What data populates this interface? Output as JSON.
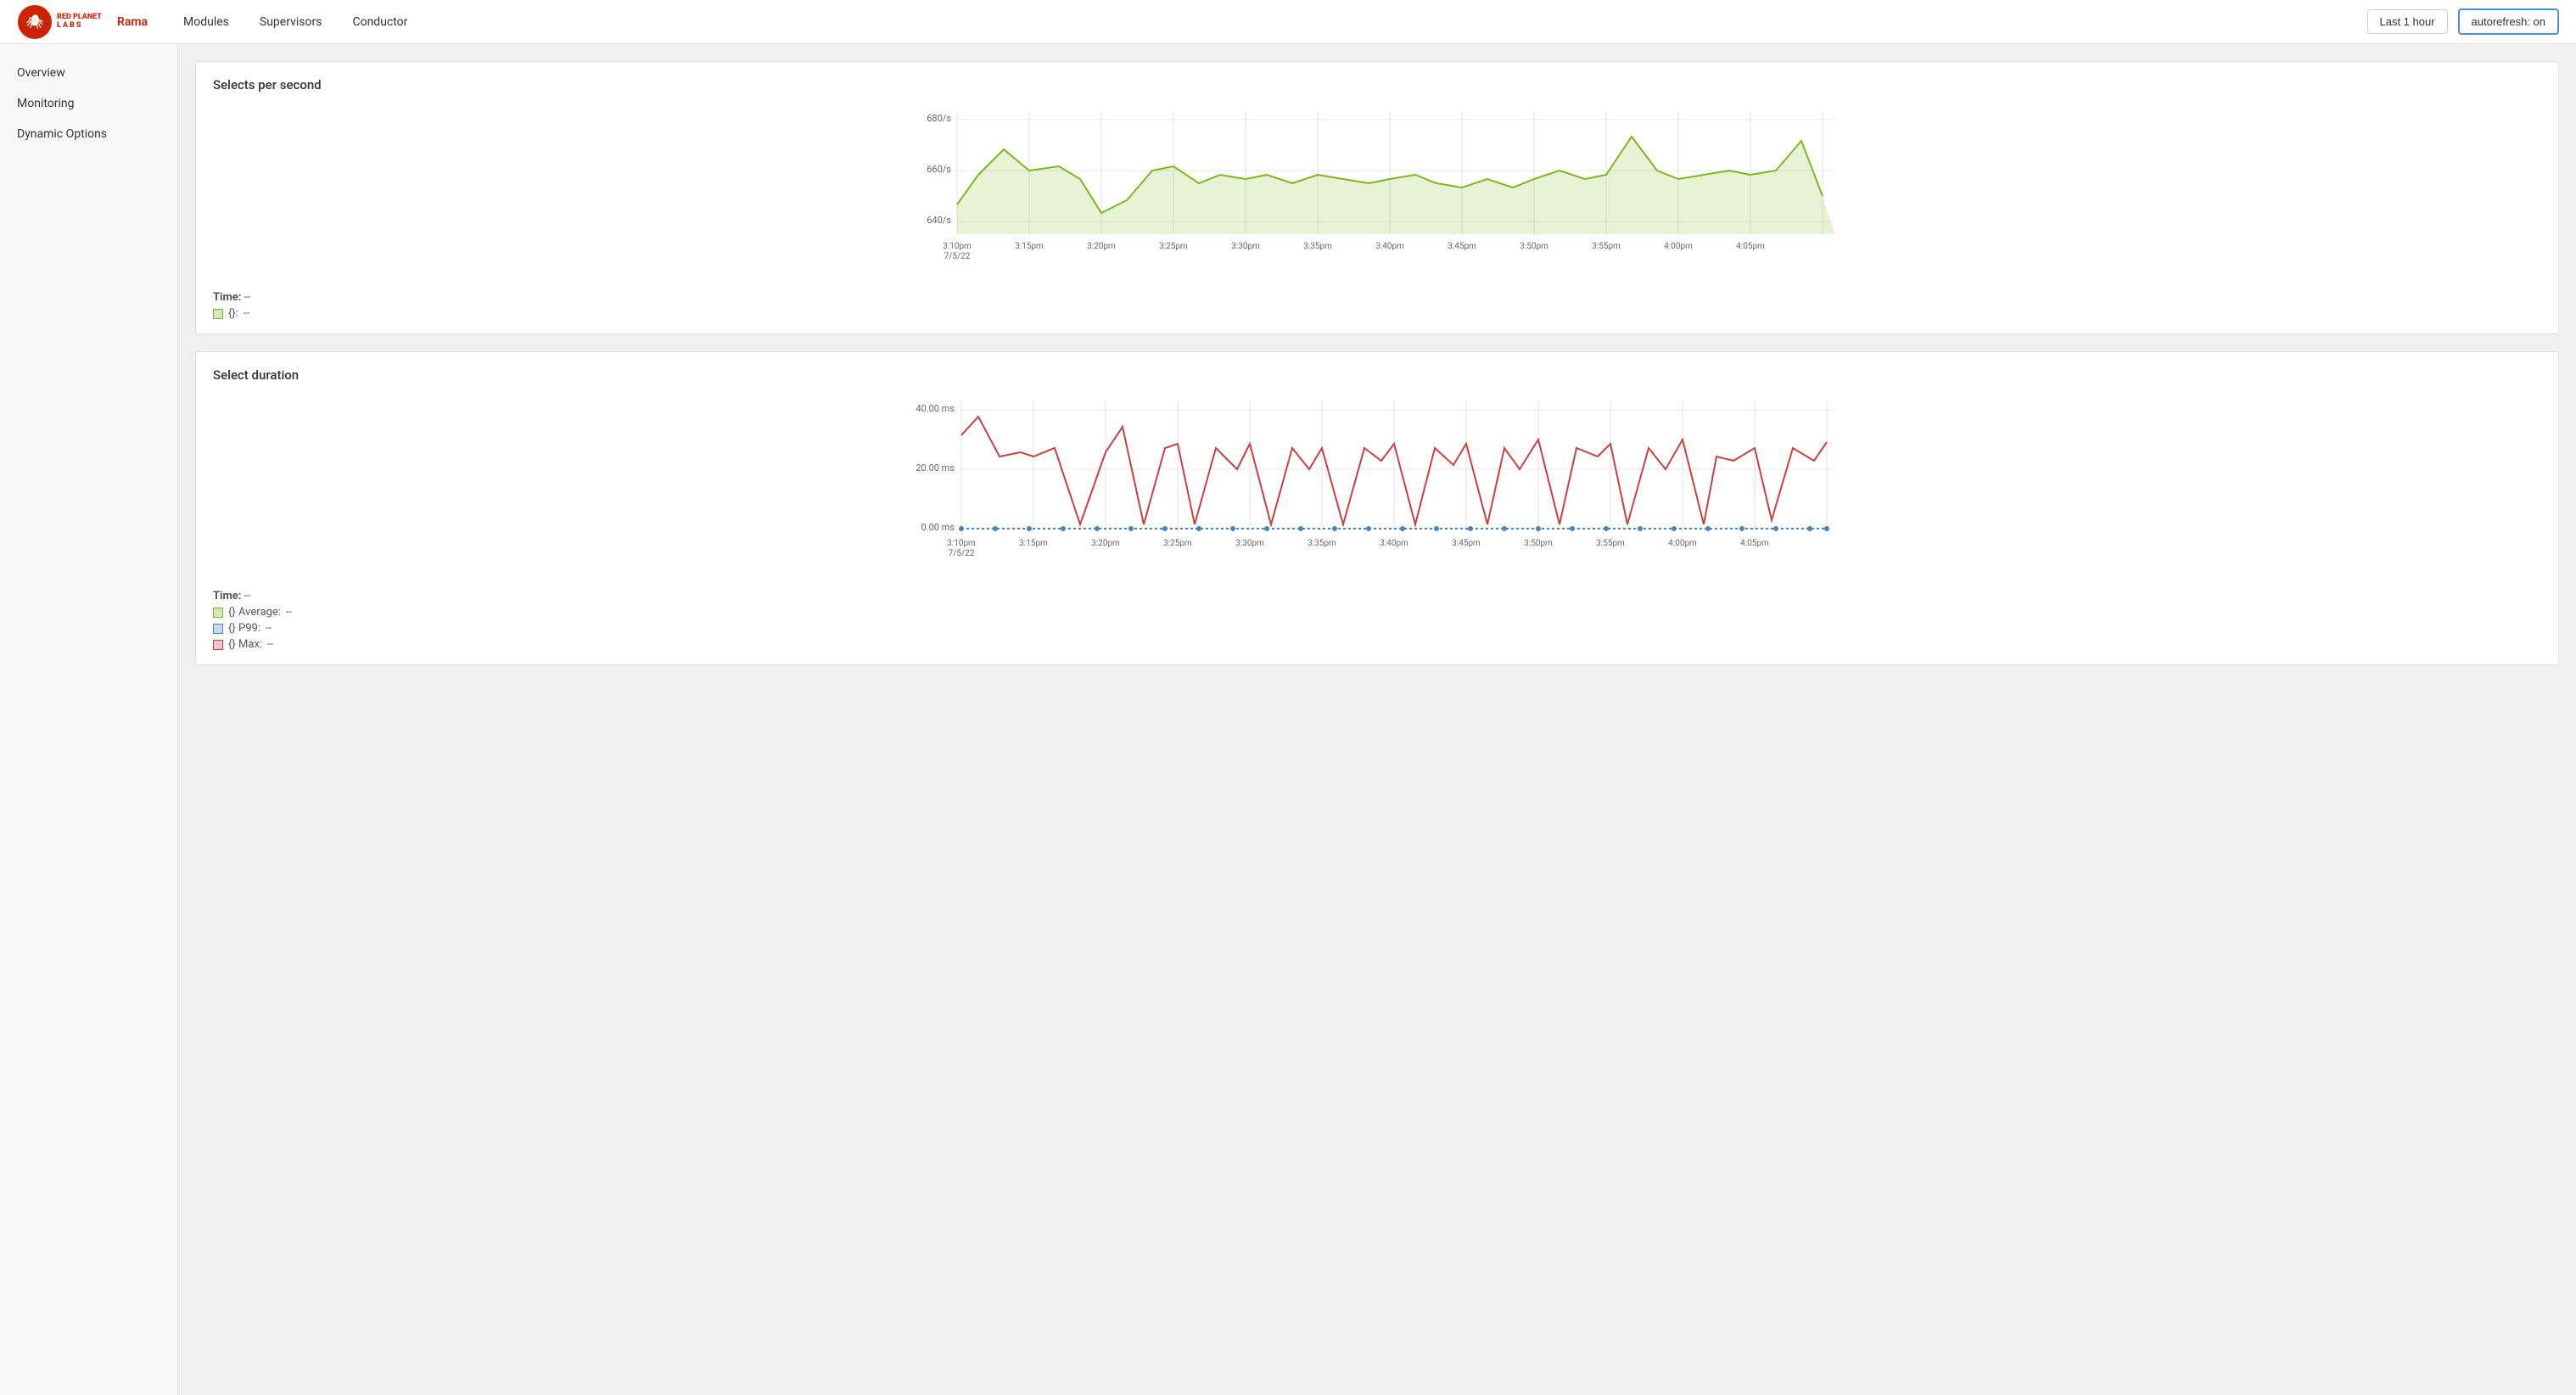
{
  "header": {
    "brand_line1": "RED PLANET",
    "brand_line2": "LABS",
    "app_name": "Rama",
    "nav_items": [
      "Modules",
      "Supervisors",
      "Conductor"
    ],
    "time_range_label": "Last 1 hour",
    "autorefresh_label": "autorefresh: on"
  },
  "sidebar": {
    "items": [
      {
        "label": "Overview"
      },
      {
        "label": "Monitoring"
      },
      {
        "label": "Dynamic Options"
      }
    ]
  },
  "chart1": {
    "title": "Selects per second",
    "y_labels": [
      "680/s",
      "660/s",
      "640/s"
    ],
    "x_labels": [
      "3:10pm\n7/5/22",
      "3:15pm",
      "3:20pm",
      "3:25pm",
      "3:30pm",
      "3:35pm",
      "3:40pm",
      "3:45pm",
      "3:50pm",
      "3:55pm",
      "4:00pm",
      "4:05pm"
    ],
    "legend_time_label": "Time:",
    "legend_time_value": "--",
    "legend_series_label": "{}:",
    "legend_series_value": "--"
  },
  "chart2": {
    "title": "Select duration",
    "y_labels": [
      "40.00 ms",
      "20.00 ms",
      "0.00 ms"
    ],
    "x_labels": [
      "3:10pm\n7/5/22",
      "3:15pm",
      "3:20pm",
      "3:25pm",
      "3:30pm",
      "3:35pm",
      "3:40pm",
      "3:45pm",
      "3:50pm",
      "3:55pm",
      "4:00pm",
      "4:05pm"
    ],
    "legend_time_label": "Time:",
    "legend_time_value": "--",
    "legend_avg_label": "{} Average:",
    "legend_avg_value": "--",
    "legend_p99_label": "{} P99:",
    "legend_p99_value": "--",
    "legend_max_label": "{} Max:",
    "legend_max_value": "--"
  }
}
